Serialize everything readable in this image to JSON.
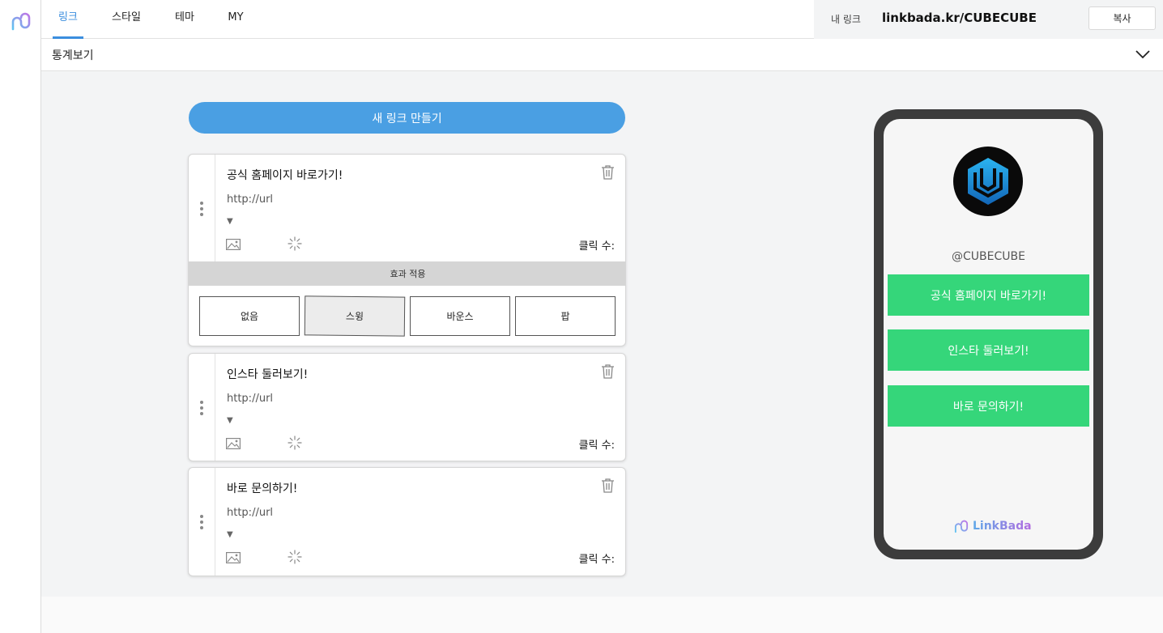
{
  "nav": {
    "tabs": [
      {
        "label": "링크",
        "active": true
      },
      {
        "label": "스타일",
        "active": false
      },
      {
        "label": "테마",
        "active": false
      },
      {
        "label": "MY",
        "active": false
      }
    ],
    "my_link_label": "내 링크",
    "my_link_url": "linkbada.kr/CUBECUBE",
    "copy_label": "복사"
  },
  "stats": {
    "label": "통계보기"
  },
  "editor": {
    "new_link_label": "새 링크 만들기",
    "links": [
      {
        "title": "공식 홈페이지 바로가기!",
        "url": "http://url",
        "arrow": "▼",
        "clicks_label": "클릭 수:"
      },
      {
        "title": "인스타 둘러보기!",
        "url": "http://url",
        "arrow": "▼",
        "clicks_label": "클릭 수:"
      },
      {
        "title": "바로 문의하기!",
        "url": "http://url",
        "arrow": "▼",
        "clicks_label": "클릭 수:"
      }
    ],
    "effect_panel": {
      "title": "효과 적용",
      "options": [
        "없음",
        "스윙",
        "바운스",
        "팝"
      ],
      "selected": "스윙"
    }
  },
  "preview": {
    "handle": "@CUBECUBE",
    "buttons": [
      "공식 홈페이지 바로가기!",
      "인스타 둘러보기!",
      "바로 문의하기!"
    ],
    "brand": "LinkBada",
    "button_color": "#35d67a"
  },
  "colors": {
    "accent": "#3b8ede",
    "primary_button": "#4a9fe3"
  }
}
